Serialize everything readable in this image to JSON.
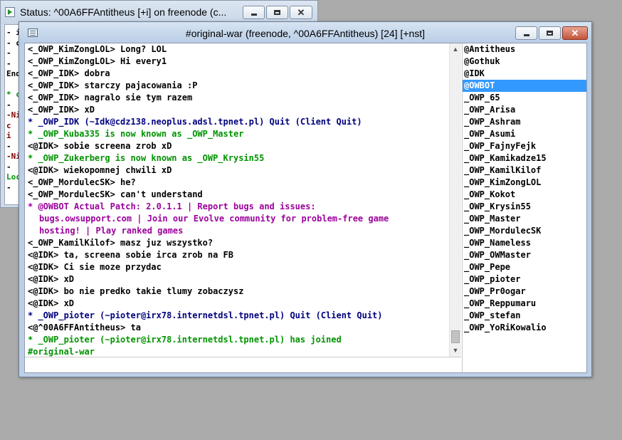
{
  "status_window": {
    "title": "Status: ^00A6FFAntitheus [+i] on freenode (c...",
    "fragments": [
      {
        "text": "- i",
        "color": "#000000"
      },
      {
        "text": "- c",
        "color": "#000000"
      },
      {
        "text": "-",
        "color": "#000000"
      },
      {
        "text": "-",
        "color": "#000000"
      },
      {
        "text": "End",
        "color": "#000000"
      },
      {
        "text": "",
        "color": "#000000"
      },
      {
        "text": "* c",
        "color": "#009300"
      },
      {
        "text": "-",
        "color": "#000000"
      },
      {
        "text": "-Ni",
        "color": "#7f0000"
      },
      {
        "text": "  c",
        "color": "#7f0000"
      },
      {
        "text": "  i",
        "color": "#7f0000"
      },
      {
        "text": "-",
        "color": "#000000"
      },
      {
        "text": "-Ni",
        "color": "#7f0000"
      },
      {
        "text": "-",
        "color": "#000000"
      },
      {
        "text": "Loc",
        "color": "#009300"
      },
      {
        "text": "-",
        "color": "#000000"
      }
    ]
  },
  "channel_window": {
    "title": "#original-war (freenode, ^00A6FFAntitheus) [24] [+nst]",
    "messages": [
      {
        "text": "<_OWP_KimZongLOL> Long? LOL",
        "color": "#000000"
      },
      {
        "text": "<_OWP_KimZongLOL> Hi every1",
        "color": "#000000"
      },
      {
        "text": "<_OWP_IDK> dobra",
        "color": "#000000"
      },
      {
        "text": "<_OWP_IDK> starczy pajacowania :P",
        "color": "#000000"
      },
      {
        "text": "<_OWP_IDK> nagralo sie tym razem",
        "color": "#000000"
      },
      {
        "text": "<_OWP_IDK> xD",
        "color": "#000000"
      },
      {
        "text": "* _OWP_IDK (~Idk@cdz138.neoplus.adsl.tpnet.pl) Quit (Client Quit)",
        "color": "#00007f"
      },
      {
        "text": "* _OWP_Kuba335 is now known as _OWP_Master",
        "color": "#009300"
      },
      {
        "text": "<@IDK> sobie screena zrob xD",
        "color": "#000000"
      },
      {
        "text": "* _OWP_Zukerberg is now known as _OWP_Krysin55",
        "color": "#009300"
      },
      {
        "text": "<@IDK> wiekopomnej chwili xD",
        "color": "#000000"
      },
      {
        "text": "<_OWP_MordulecSK> he?",
        "color": "#000000"
      },
      {
        "text": "<_OWP_MordulecSK> can't understand",
        "color": "#000000"
      },
      {
        "text": "* @OWBOT Actual Patch: 2.0.1.1 | Report bugs and issues:",
        "color": "#9c009c"
      },
      {
        "text": "bugs.owsupport.com | Join our Evolve community for problem-free game",
        "color": "#9c009c",
        "cont": true
      },
      {
        "text": "hosting! | Play ranked games",
        "color": "#9c009c",
        "cont": true
      },
      {
        "text": "<_OWP_KamilKilof> masz juz wszystko?",
        "color": "#000000"
      },
      {
        "text": "<@IDK> ta, screena sobie irca zrob na FB",
        "color": "#000000"
      },
      {
        "text": "<@IDK> Ci sie moze przydac",
        "color": "#000000"
      },
      {
        "text": "<@IDK> xD",
        "color": "#000000"
      },
      {
        "text": "<@IDK> bo nie predko takie tlumy zobaczysz",
        "color": "#000000"
      },
      {
        "text": "<@IDK> xD",
        "color": "#000000"
      },
      {
        "text": "* _OWP_pioter (~pioter@irx78.internetdsl.tpnet.pl) Quit (Client Quit)",
        "color": "#00007f"
      },
      {
        "text": "<@^00A6FFAntitheus> ta",
        "color": "#000000"
      },
      {
        "text": "* _OWP_pioter (~pioter@irx78.internetdsl.tpnet.pl) has joined",
        "color": "#009300"
      },
      {
        "text": "#original-war",
        "color": "#009300"
      }
    ],
    "input_value": "",
    "nicks": [
      "@Antitheus",
      "@Gothuk",
      "@IDK",
      "@OWBOT",
      "_OWP_65",
      "_OWP_Arisa",
      "_OWP_Ashram",
      "_OWP_Asumi",
      "_OWP_FajnyFejk",
      "_OWP_Kamikadze15",
      "_OWP_KamilKilof",
      "_OWP_KimZongLOL",
      "_OWP_Kokot",
      "_OWP_Krysin55",
      "_OWP_Master",
      "_OWP_MordulecSK",
      "_OWP_Nameless",
      "_OWP_OWMaster",
      "_OWP_Pepe",
      "_OWP_pioter",
      "_OWP_Pr0ogar",
      "_OWP_Reppumaru",
      "_OWP_stefan",
      "_OWP_YoRiKowalio"
    ],
    "selected_nick_index": 3,
    "icons": {
      "minimize": "minimize-icon",
      "maximize": "maximize-icon",
      "close": "close-icon",
      "scroll_up": "scroll-up-icon",
      "scroll_down": "scroll-down-icon"
    }
  }
}
